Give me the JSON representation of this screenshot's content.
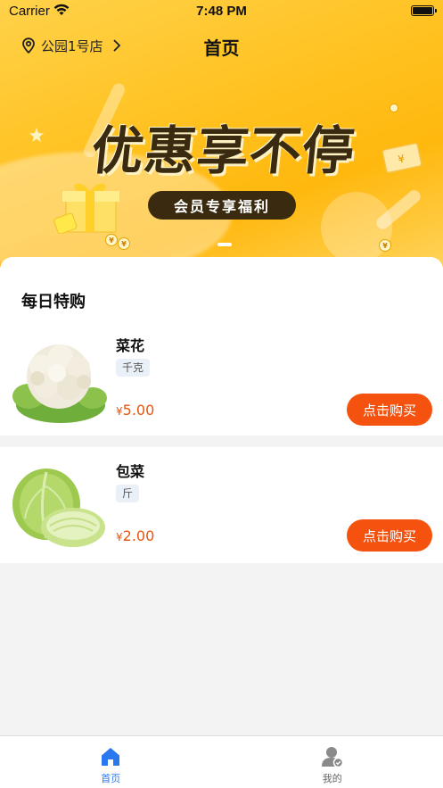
{
  "status_bar": {
    "carrier": "Carrier",
    "time": "7:48 PM"
  },
  "nav": {
    "store_name": "公园1号店",
    "title": "首页"
  },
  "banner": {
    "headline": "优惠享不停",
    "subline": "会员专享福利",
    "coin_symbol": "¥",
    "ticket_symbol": "¥",
    "pages": 1,
    "current_page": 1
  },
  "section": {
    "title": "每日特购"
  },
  "products": [
    {
      "name": "菜花",
      "unit": "千克",
      "currency": "¥",
      "price": "5.00",
      "buy_label": "点击购买",
      "thumb_icon": "cauliflower-image"
    },
    {
      "name": "包菜",
      "unit": "斤",
      "currency": "¥",
      "price": "2.00",
      "buy_label": "点击购买",
      "thumb_icon": "cabbage-image"
    }
  ],
  "tabbar": {
    "tabs": [
      {
        "label": "首页",
        "icon": "home-icon",
        "active": true
      },
      {
        "label": "我的",
        "icon": "profile-icon",
        "active": false
      }
    ]
  },
  "colors": {
    "accent": "#2a78f0",
    "buy": "#f5520f",
    "price": "#e8560f",
    "banner": "#ffc11f"
  }
}
